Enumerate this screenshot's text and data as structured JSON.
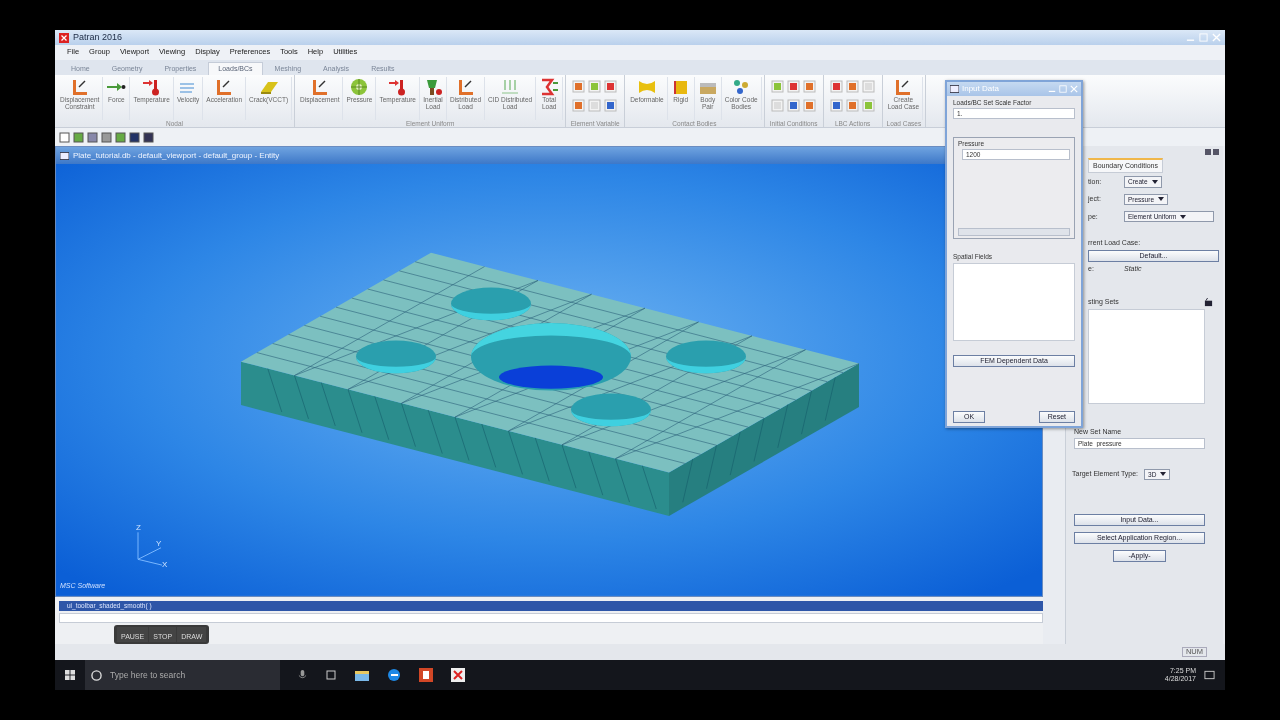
{
  "window": {
    "title": "Patran 2016"
  },
  "menu": [
    "File",
    "Group",
    "Viewport",
    "Viewing",
    "Display",
    "Preferences",
    "Tools",
    "Help",
    "Utilities"
  ],
  "ribbon_tabs": [
    {
      "label": "Home",
      "selected": false
    },
    {
      "label": "Geometry",
      "selected": false
    },
    {
      "label": "Properties",
      "selected": false
    },
    {
      "label": "Loads/BCs",
      "selected": true
    },
    {
      "label": "Meshing",
      "selected": false
    },
    {
      "label": "Analysis",
      "selected": false
    },
    {
      "label": "Results",
      "selected": false
    }
  ],
  "ribbon_groups": [
    {
      "title": "Nodal",
      "kind": "buttons",
      "tools": [
        [
          "Displacement",
          "Constraint"
        ],
        [
          "Force"
        ],
        [
          "Temperature"
        ],
        [
          "Velocity"
        ],
        [
          "Acceleration"
        ],
        [
          "Crack(VCCT)"
        ]
      ]
    },
    {
      "title": "Element Uniform",
      "kind": "buttons",
      "tools": [
        [
          "Displacement"
        ],
        [
          "Pressure"
        ],
        [
          "Temperature"
        ],
        [
          "Inertial",
          "Load"
        ],
        [
          "Distributed",
          "Load"
        ],
        [
          "CID Distributed",
          "Load"
        ],
        [
          "Total",
          "Load"
        ]
      ]
    },
    {
      "title": "Element Variable",
      "kind": "icon_grid"
    },
    {
      "title": "Contact Bodies",
      "kind": "buttons",
      "tools": [
        [
          "Deformable"
        ],
        [
          "Rigid"
        ],
        [
          "Body",
          "Pair"
        ],
        [
          "Color Code",
          "Bodies"
        ]
      ]
    },
    {
      "title": "Initial Conditions",
      "kind": "icon_grid"
    },
    {
      "title": "LBC Actions",
      "kind": "icon_grid"
    },
    {
      "title": "Load Cases",
      "kind": "buttons",
      "tools": [
        [
          "Create",
          "Load Case"
        ]
      ]
    }
  ],
  "viewport": {
    "title": "Plate_tutorial.db - default_viewport - default_group - Entity",
    "logo": "MSC Software",
    "triad_labels": [
      "Z",
      "Y",
      "X"
    ]
  },
  "dialog": {
    "title": "Input Data",
    "scale_factor_label": "Loads/BC Set Scale Factor",
    "scale_factor": "1.",
    "field_label": "Pressure",
    "field_value": "1200",
    "spatial_fields_label": "Spatial Fields",
    "fem_button": "FEM Dependent Data",
    "ok": "OK",
    "reset": "Reset"
  },
  "panel": {
    "tab": "Boundary Conditions",
    "rows": [
      {
        "label": "tion:",
        "value": "Create"
      },
      {
        "label": "ject:",
        "value": "Pressure"
      },
      {
        "label": "pe:",
        "value": "Element Uniform"
      }
    ],
    "load_case_label": "rrent Load Case:",
    "load_case": "Default...",
    "type_label": "e:",
    "type_value": "Static",
    "existing_sets_label": "sting Sets",
    "new_set_label": "New Set Name",
    "new_set_value": "Plate_pressure",
    "target_label": "Target Element Type:",
    "target_value": "3D",
    "buttons": [
      "Input Data...",
      "Select Application Region..."
    ],
    "apply": "-Apply-"
  },
  "command": {
    "history": "ui_toolbar_shaded_smooth( )"
  },
  "recorder": [
    "PAUSE",
    "STOP",
    "DRAW"
  ],
  "status": "NUM",
  "taskbar": {
    "search_placeholder": "Type here to search",
    "time": "7:25 PM",
    "date": "4/28/2017"
  }
}
